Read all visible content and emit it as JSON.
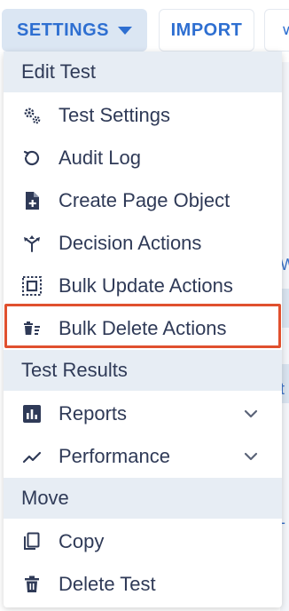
{
  "toolbar": {
    "settings_label": "SETTINGS",
    "import_label": "IMPORT",
    "more_label": "∨"
  },
  "menu": {
    "sections": [
      {
        "title": "Edit Test"
      },
      {
        "title": "Test Results"
      },
      {
        "title": "Move"
      }
    ],
    "edit_items": [
      {
        "label": "Test Settings",
        "icon": "gears-icon"
      },
      {
        "label": "Audit Log",
        "icon": "history-icon"
      },
      {
        "label": "Create Page Object",
        "icon": "file-plus-icon"
      },
      {
        "label": "Decision Actions",
        "icon": "decision-arrows-icon"
      },
      {
        "label": "Bulk Update Actions",
        "icon": "bulk-select-icon"
      },
      {
        "label": "Bulk Delete Actions",
        "icon": "bulk-delete-icon",
        "highlighted": true
      }
    ],
    "result_items": [
      {
        "label": "Reports",
        "icon": "bar-chart-icon"
      },
      {
        "label": "Performance",
        "icon": "trend-line-icon"
      }
    ],
    "move_items": [
      {
        "label": "Copy",
        "icon": "copy-icon"
      },
      {
        "label": "Delete Test",
        "icon": "trash-icon"
      }
    ]
  },
  "background": {
    "edge_chars": [
      "W",
      "t",
      "-"
    ]
  },
  "colors": {
    "accent": "#2e6fd1",
    "highlight_border": "#e0502e",
    "section_bg": "#e7edf4",
    "text": "#2f3a57"
  }
}
